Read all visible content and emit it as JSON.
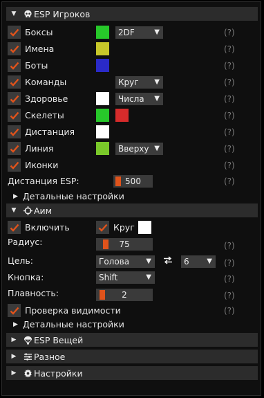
{
  "colors": {
    "accent": "#e0531b",
    "check": "#e0531b",
    "green": "#27c82a",
    "yellow": "#c8c82a",
    "blue": "#2a2ac8",
    "white": "#ffffff",
    "red": "#d62b2b",
    "lime": "#7ac82a"
  },
  "esp_players": {
    "title": "ESP Игроков",
    "rows": [
      {
        "label": "Боксы",
        "checked": true,
        "combo": "2DF",
        "help": "(?)"
      },
      {
        "label": "Имена",
        "checked": true,
        "help": "(?)"
      },
      {
        "label": "Боты",
        "checked": true,
        "help": "(?)"
      },
      {
        "label": "Команды",
        "checked": true,
        "combo": "Круг",
        "help": "(?)"
      },
      {
        "label": "Здоровье",
        "checked": true,
        "combo": "Числа",
        "help": "(?)"
      },
      {
        "label": "Скелеты",
        "checked": true,
        "help": "(?)"
      },
      {
        "label": "Дистанция",
        "checked": true,
        "help": "(?)"
      },
      {
        "label": "Линия",
        "checked": true,
        "combo": "Вверху",
        "help": "(?)"
      },
      {
        "label": "Иконки",
        "checked": true,
        "help": "(?)"
      }
    ],
    "distance": {
      "label": "Дистанция ESP:",
      "value": "500",
      "help": "(?)"
    },
    "advanced": "Детальные настройки"
  },
  "aim": {
    "title": "Аим",
    "enable": {
      "label": "Включить",
      "checked": true
    },
    "circle": {
      "label": "Круг",
      "checked": true
    },
    "radius": {
      "label": "Радиус:",
      "value": "75",
      "help": "(?)"
    },
    "target": {
      "label": "Цель:",
      "value": "Голова",
      "extra": "6",
      "help": "(?)"
    },
    "key": {
      "label": "Кнопка:",
      "value": "Shift",
      "help": "(?)"
    },
    "smooth": {
      "label": "Плавность:",
      "value": "2",
      "help": "(?)"
    },
    "visibility": {
      "label": "Проверка видимости",
      "checked": true,
      "help": "(?)"
    },
    "advanced": "Детальные настройки"
  },
  "sections": {
    "items": {
      "title": "ESP Вещей"
    },
    "misc": {
      "title": "Разное"
    },
    "settings": {
      "title": "Настройки"
    }
  }
}
